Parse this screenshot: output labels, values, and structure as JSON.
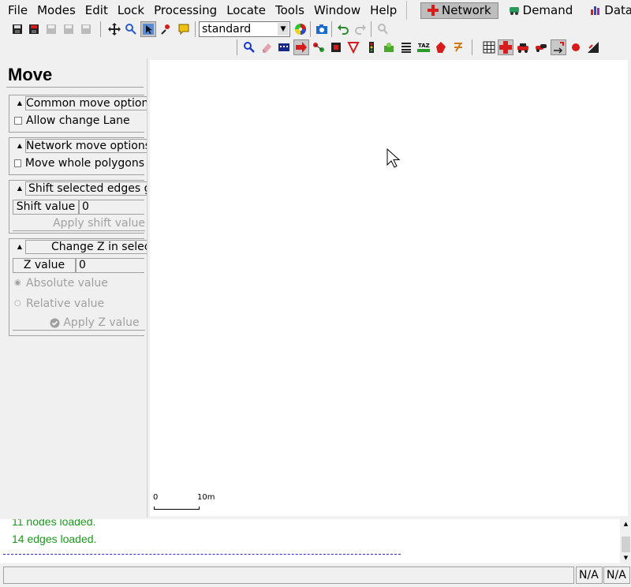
{
  "menu": {
    "items": [
      {
        "label": "File"
      },
      {
        "label": "Modes"
      },
      {
        "label": "Edit"
      },
      {
        "label": "Lock"
      },
      {
        "label": "Processing"
      },
      {
        "label": "Locate"
      },
      {
        "label": "Tools"
      },
      {
        "label": "Window"
      },
      {
        "label": "Help"
      }
    ]
  },
  "supermodes": {
    "network": "Network",
    "demand": "Demand",
    "data": "Data",
    "active": "network"
  },
  "toolbar": {
    "scheme_value": "standard"
  },
  "panel": {
    "title": "Move",
    "common": {
      "title": "Common move options",
      "allow_change_lane": "Allow change Lane"
    },
    "network": {
      "title": "Network move options",
      "move_whole_polygons": "Move whole polygons"
    },
    "shift": {
      "title": "Shift selected edges geometry",
      "shift_value_label": "Shift value",
      "shift_value": "0",
      "apply_label": "Apply shift value"
    },
    "changez": {
      "title": "Change Z in selection",
      "z_value_label": "Z value",
      "z_value": "0",
      "absolute_label": "Absolute value",
      "relative_label": "Relative value",
      "apply_label": "Apply Z value"
    }
  },
  "canvas": {
    "scale_start": "0",
    "scale_end": "10m"
  },
  "messages": [
    "11 nodes loaded.",
    "14 edges loaded."
  ],
  "status": {
    "cell1": "N/A",
    "cell2": "N/A"
  },
  "colors": {
    "message_green": "#1a9a1a",
    "separator_blue": "#2a2ad0",
    "active_mode": "#bdbdbd"
  }
}
